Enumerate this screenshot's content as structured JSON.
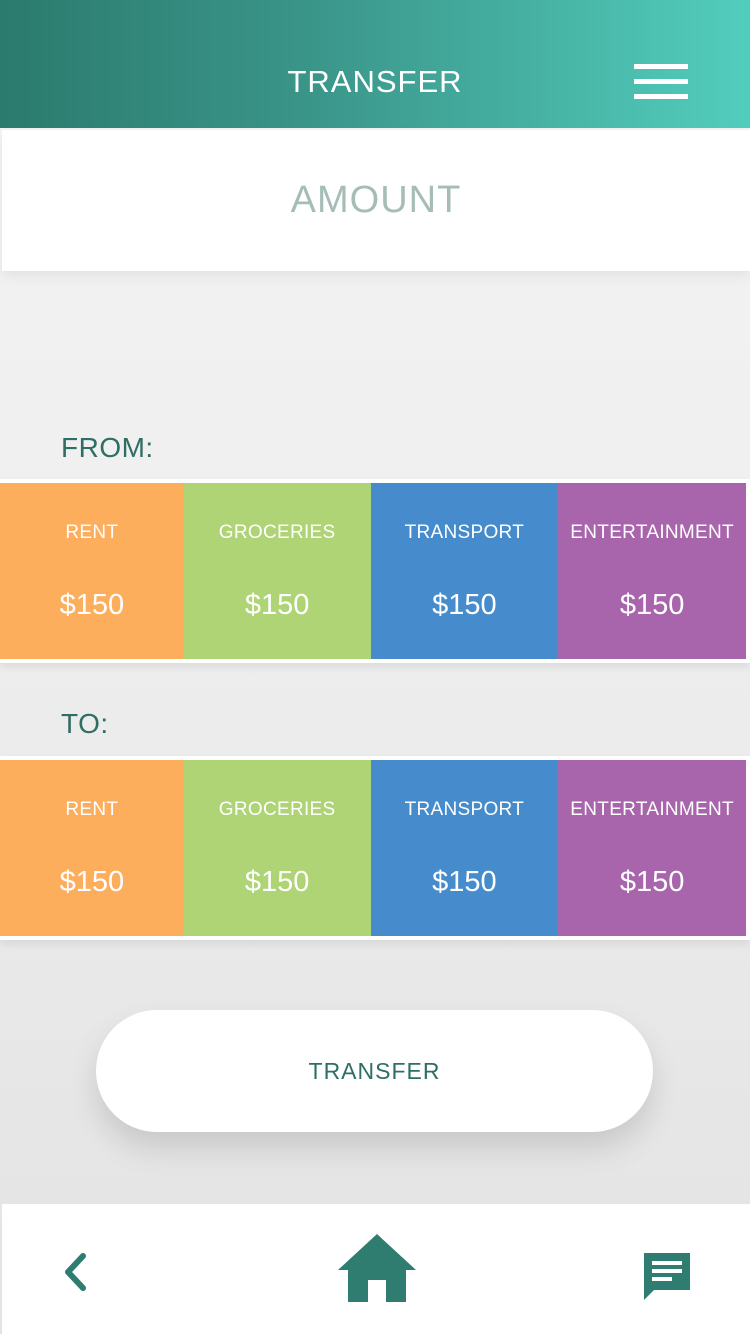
{
  "header": {
    "title": "TRANSFER",
    "menu_icon": "hamburger-menu-icon"
  },
  "amount": {
    "placeholder": "AMOUNT",
    "value": ""
  },
  "from": {
    "label": "FROM:",
    "categories": [
      {
        "name": "RENT",
        "amount": "$150",
        "color": "#fdae5d"
      },
      {
        "name": "GROCERIES",
        "amount": "$150",
        "color": "#aed475"
      },
      {
        "name": "TRANSPORT",
        "amount": "$150",
        "color": "#468ccd"
      },
      {
        "name": "ENTERTAINMENT",
        "amount": "$150",
        "color": "#a865ab"
      }
    ]
  },
  "to": {
    "label": "TO:",
    "categories": [
      {
        "name": "RENT",
        "amount": "$150",
        "color": "#fdae5d"
      },
      {
        "name": "GROCERIES",
        "amount": "$150",
        "color": "#aed475"
      },
      {
        "name": "TRANSPORT",
        "amount": "$150",
        "color": "#468ccd"
      },
      {
        "name": "ENTERTAINMENT",
        "amount": "$150",
        "color": "#a865ab"
      }
    ]
  },
  "transfer_button": {
    "label": "TRANSFER"
  },
  "bottom_nav": {
    "back_icon": "chevron-left-icon",
    "home_icon": "home-icon",
    "chat_icon": "chat-icon"
  },
  "colors": {
    "header_start": "#2b7b6e",
    "header_end": "#52cdbd",
    "accent": "#2e6e64",
    "placeholder": "#a6bdb7"
  }
}
